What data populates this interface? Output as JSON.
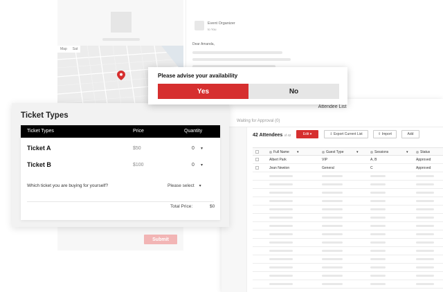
{
  "event_page": {
    "submit_label": "Submit"
  },
  "email": {
    "from": "Event Organizer",
    "to": "to You",
    "greeting": "Dear Amanda,"
  },
  "availability": {
    "question": "Please advise your availability",
    "yes_label": "Yes",
    "no_label": "No"
  },
  "ticket_types": {
    "title": "Ticket Types",
    "headers": {
      "type": "Ticket Types",
      "price": "Price",
      "quantity": "Quantity"
    },
    "rows": [
      {
        "name": "Ticket A",
        "price": "$50",
        "quantity": "0"
      },
      {
        "name": "Ticket B",
        "price": "$100",
        "quantity": "0"
      }
    ],
    "question": "Which ticket you are buying for yourself?",
    "select_placeholder": "Please select",
    "total_label": "Total Price:",
    "total_value": "$0"
  },
  "attendee_list": {
    "title": "Attendee List",
    "tab": "Waiting for Approval (0)",
    "count_label": "42 Attendees",
    "count_sub": "of 42",
    "edit_label": "Edit",
    "export_label": "Export Current List",
    "import_label": "Import",
    "add_label": "Add",
    "columns": [
      "Full Name",
      "Guest Type",
      "Sessions",
      "Status"
    ],
    "rows": [
      {
        "name": "Albert Park",
        "guest_type": "VIP",
        "sessions": "A, B",
        "status": "Approved"
      },
      {
        "name": "Jean Newton",
        "guest_type": "General",
        "sessions": "C",
        "status": "Approved"
      }
    ]
  }
}
